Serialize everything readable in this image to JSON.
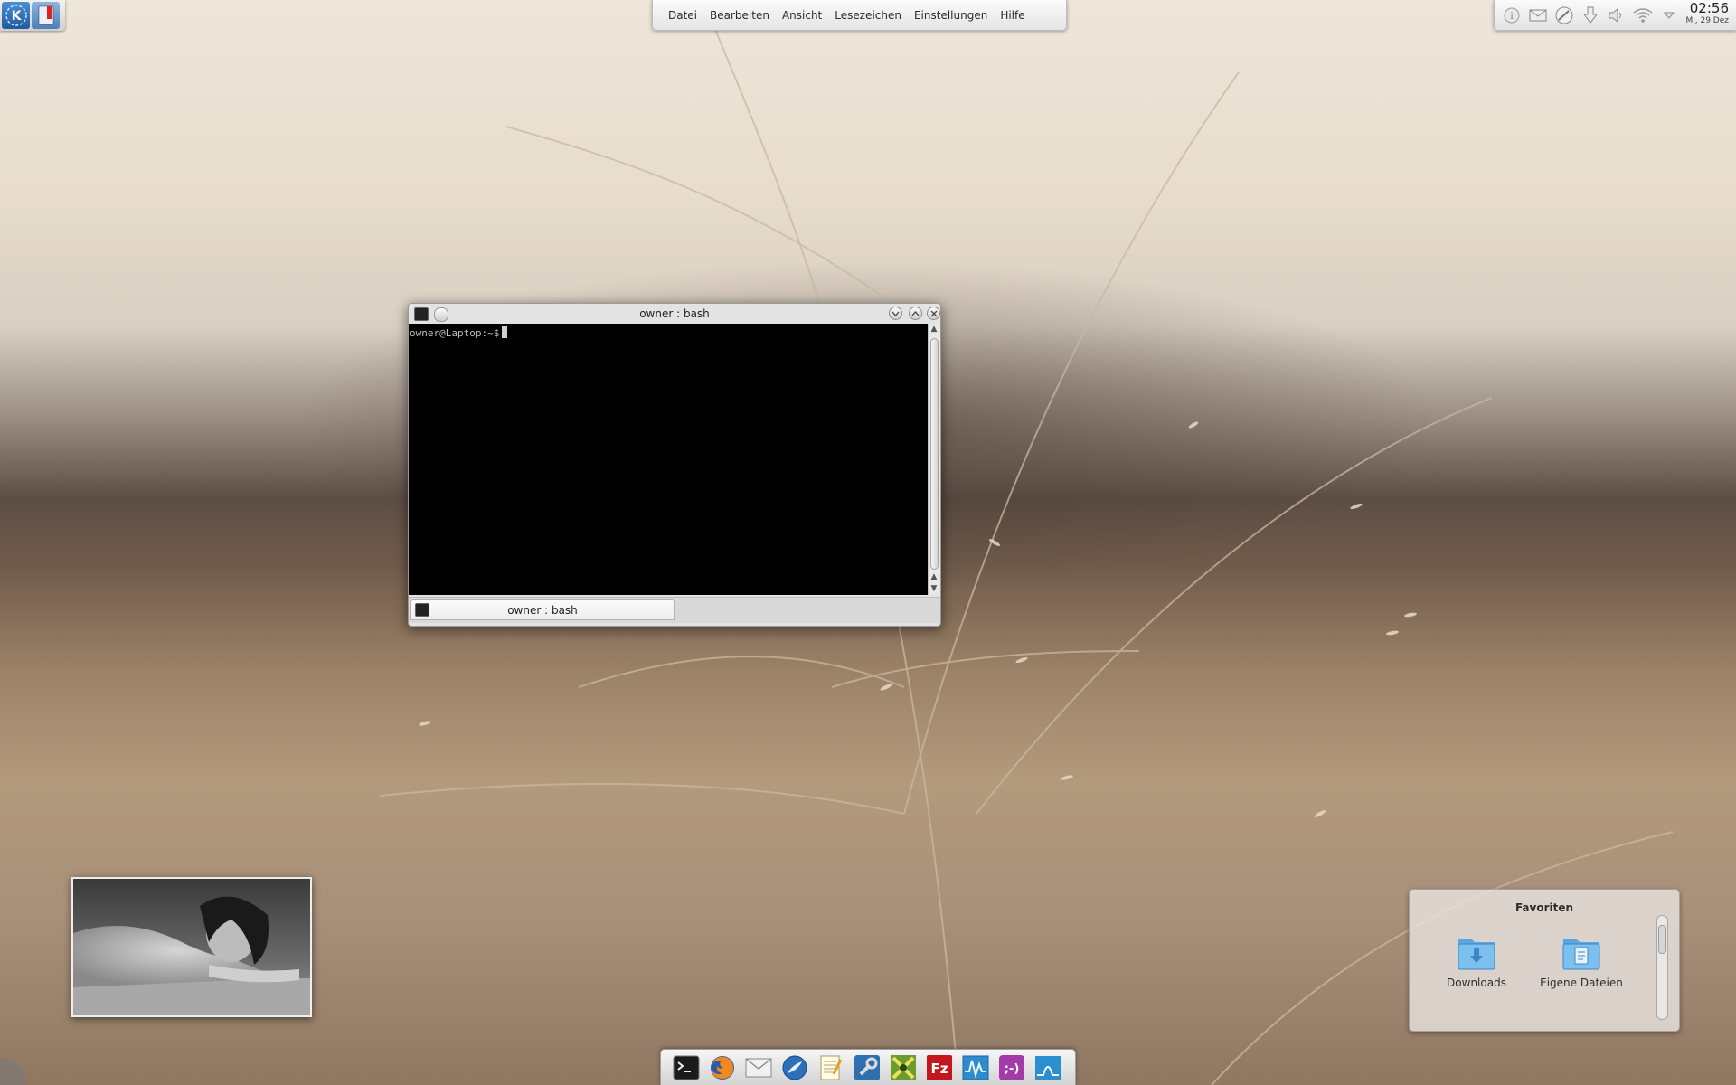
{
  "menubar": {
    "items": [
      "Datei",
      "Bearbeiten",
      "Ansicht",
      "Lesezeichen",
      "Einstellungen",
      "Hilfe"
    ]
  },
  "tray": {
    "time": "02:56",
    "date": "Mi, 29 Dez",
    "icons": [
      "info-icon",
      "mail-icon",
      "network-icon",
      "download-icon",
      "volume-icon",
      "wifi-icon",
      "expand-tray-icon"
    ]
  },
  "terminal": {
    "window_title": "owner : bash",
    "prompt": "owner@Laptop:~$",
    "tab_label": "owner : bash"
  },
  "favorites": {
    "title": "Favoriten",
    "items": [
      {
        "label": "Downloads",
        "icon": "downloads-folder-icon"
      },
      {
        "label": "Eigene Dateien",
        "icon": "documents-folder-icon"
      }
    ]
  },
  "dock": {
    "icons": [
      "terminal-icon",
      "firefox-icon",
      "mail-icon",
      "browser-icon",
      "text-editor-icon",
      "settings-tools-icon",
      "games-icon",
      "filezilla-icon",
      "system-monitor-icon",
      "chat-icon",
      "network-manager-icon"
    ]
  },
  "colors": {
    "terminal_bg": "#000000",
    "accent_blue": "#3b8fd6",
    "filezilla_red": "#c5161d"
  }
}
